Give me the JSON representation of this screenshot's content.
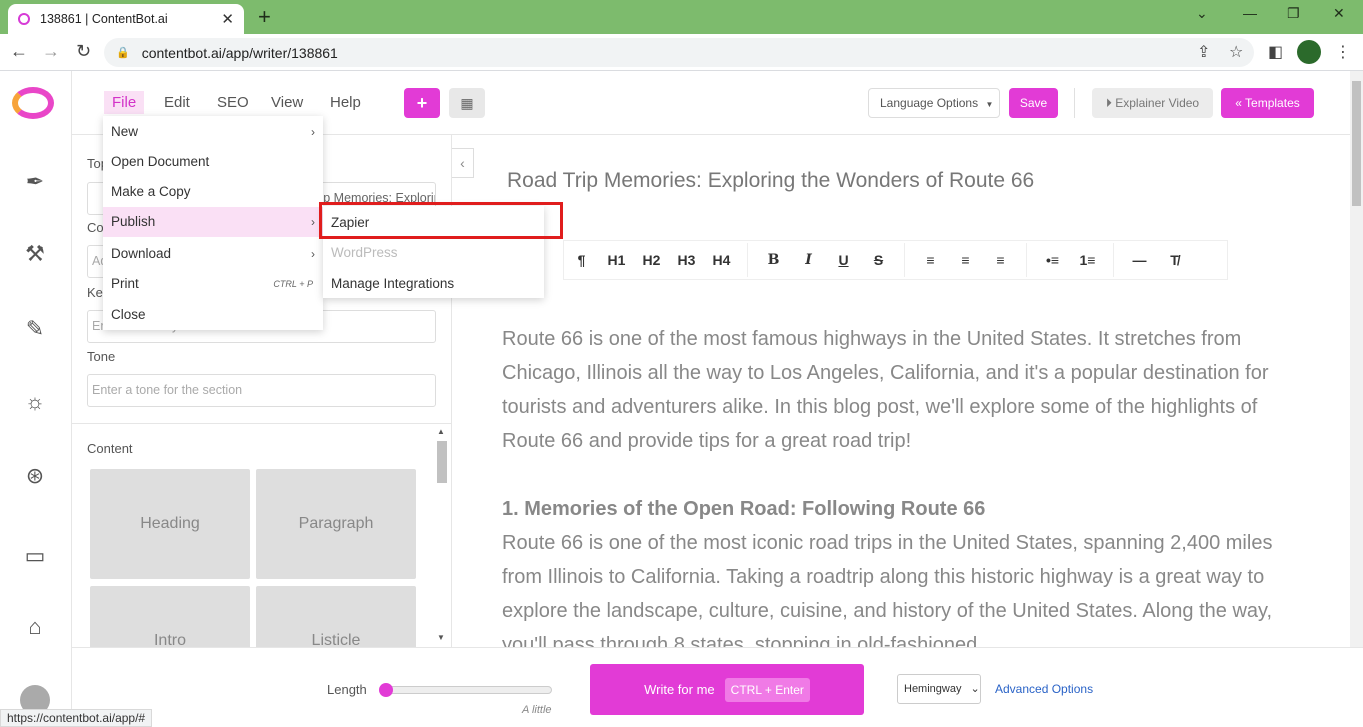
{
  "browser": {
    "tab_title": "138861 | ContentBot.ai",
    "url": "contentbot.ai/app/writer/138861",
    "status_url": "https://contentbot.ai/app/#"
  },
  "menubar": {
    "items": [
      "File",
      "Edit",
      "SEO",
      "View",
      "Help"
    ],
    "language_label": "Language Options",
    "save_label": "Save",
    "explainer_label": "Explainer Video",
    "templates_label": "Templates"
  },
  "file_menu": {
    "items": [
      {
        "label": "New"
      },
      {
        "label": "Open Document"
      },
      {
        "label": "Make a Copy"
      },
      {
        "label": "Publish"
      },
      {
        "label": "Download"
      },
      {
        "label": "Print",
        "shortcut": "CTRL + P"
      },
      {
        "label": "Close"
      }
    ]
  },
  "publish_submenu": {
    "items": [
      "Zapier",
      "WordPress",
      "Manage Integrations"
    ]
  },
  "panel": {
    "topic_label": "Top",
    "topic_value": "Road Trip Memories: Exploring the Wonders of Route 66",
    "context_label": "Co",
    "context_placeholder": "Ad",
    "keywords_label": "Key",
    "keywords_placeholder": "Enter a few keywords for the section",
    "tone_label": "Tone",
    "tone_placeholder": "Enter a tone for the section",
    "content_label": "Content",
    "tiles": [
      "Heading",
      "Paragraph",
      "Intro",
      "Listicle"
    ]
  },
  "editor": {
    "title": "Road Trip Memories: Exploring the Wonders of Route 66",
    "toolbar": [
      "¶",
      "H1",
      "H2",
      "H3",
      "H4",
      "B",
      "I",
      "U",
      "S",
      "≡",
      "≡",
      "≡",
      "•≡",
      "1≡",
      "—",
      "T̸"
    ],
    "paragraph1": "Route 66 is one of the most famous highways in the United States. It stretches from Chicago, Illinois all the way to Los Angeles, California, and it's a popular destination for tourists and adventurers alike. In this blog post, we'll explore some of the highlights of Route 66 and provide tips for a great road trip!",
    "heading1": "1. Memories of the Open Road: Following Route 66",
    "paragraph2": "Route 66 is one of the most iconic road trips in the United States, spanning 2,400 miles from Illinois to California. Taking a roadtrip along this historic highway is a great way to explore the landscape, culture, cuisine, and history of the United States. Along the way, you'll pass through 8 states, stopping in old-fashioned"
  },
  "bottom": {
    "length_label": "Length",
    "length_value_label": "A little",
    "length_level": 0,
    "write_label": "Write for me",
    "write_shortcut": "CTRL + Enter",
    "style_value": "Hemingway",
    "advanced_label": "Advanced Options"
  },
  "colors": {
    "accent": "#e23bd6",
    "highlight_box": "#e01d1d",
    "chrome_green": "#7dbb6d"
  }
}
